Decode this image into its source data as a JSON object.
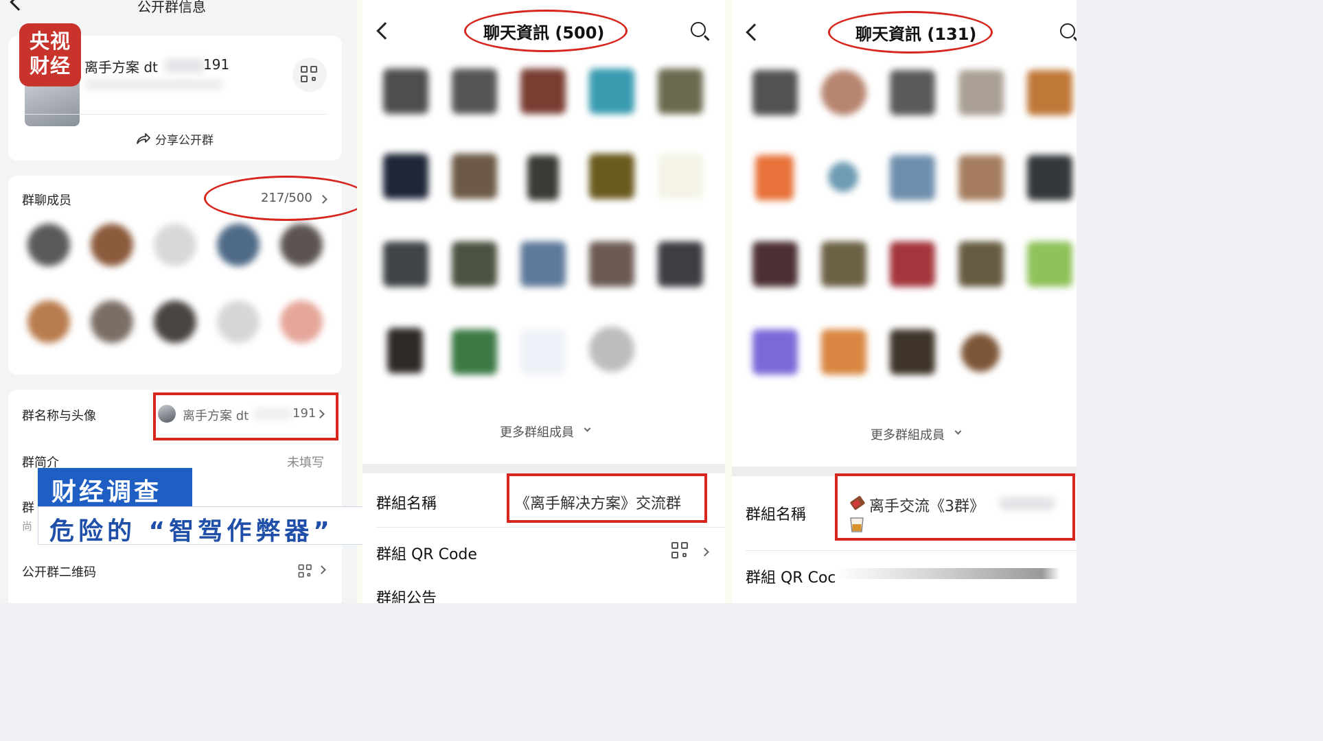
{
  "panel1": {
    "title": "公开群信息",
    "group_name_prefix": "离手方案 dt",
    "group_name_suffix": "191",
    "share_label": "分享公开群",
    "members_label": "群聊成员",
    "members_count": "217/500",
    "name_avatar_label": "群名称与头像",
    "name_avatar_value_prefix": "离手方案 dt",
    "name_avatar_value_suffix": "191",
    "intro_label": "群简介",
    "intro_value": "未填写",
    "row3_label_partial": "群",
    "row3_sub_partial": "尚",
    "qr_label": "公开群二维码"
  },
  "watermark": {
    "line1": "央视",
    "line2": "财经"
  },
  "caption": {
    "tag": "财经调查",
    "headline": "危险的 “智驾作弊器”"
  },
  "panel2": {
    "title": "聊天資訊 (500)",
    "more_members": "更多群組成員",
    "group_name_label": "群組名稱",
    "group_name_value": "《离手解决方案》交流群",
    "qr_label": "群組 QR Code",
    "notice_label": "群組公告"
  },
  "panel3": {
    "title": "聊天資訊 (131)",
    "more_members": "更多群組成員",
    "group_name_label": "群組名稱",
    "group_name_value": "离手交流《3群》",
    "qr_label_partial": "群組 QR Coc"
  },
  "colors": {
    "highlight": "#d7261e",
    "caption_blue": "#1f5fc4",
    "caption_text": "#1f4fa8",
    "logo_red": "#c8332b"
  }
}
